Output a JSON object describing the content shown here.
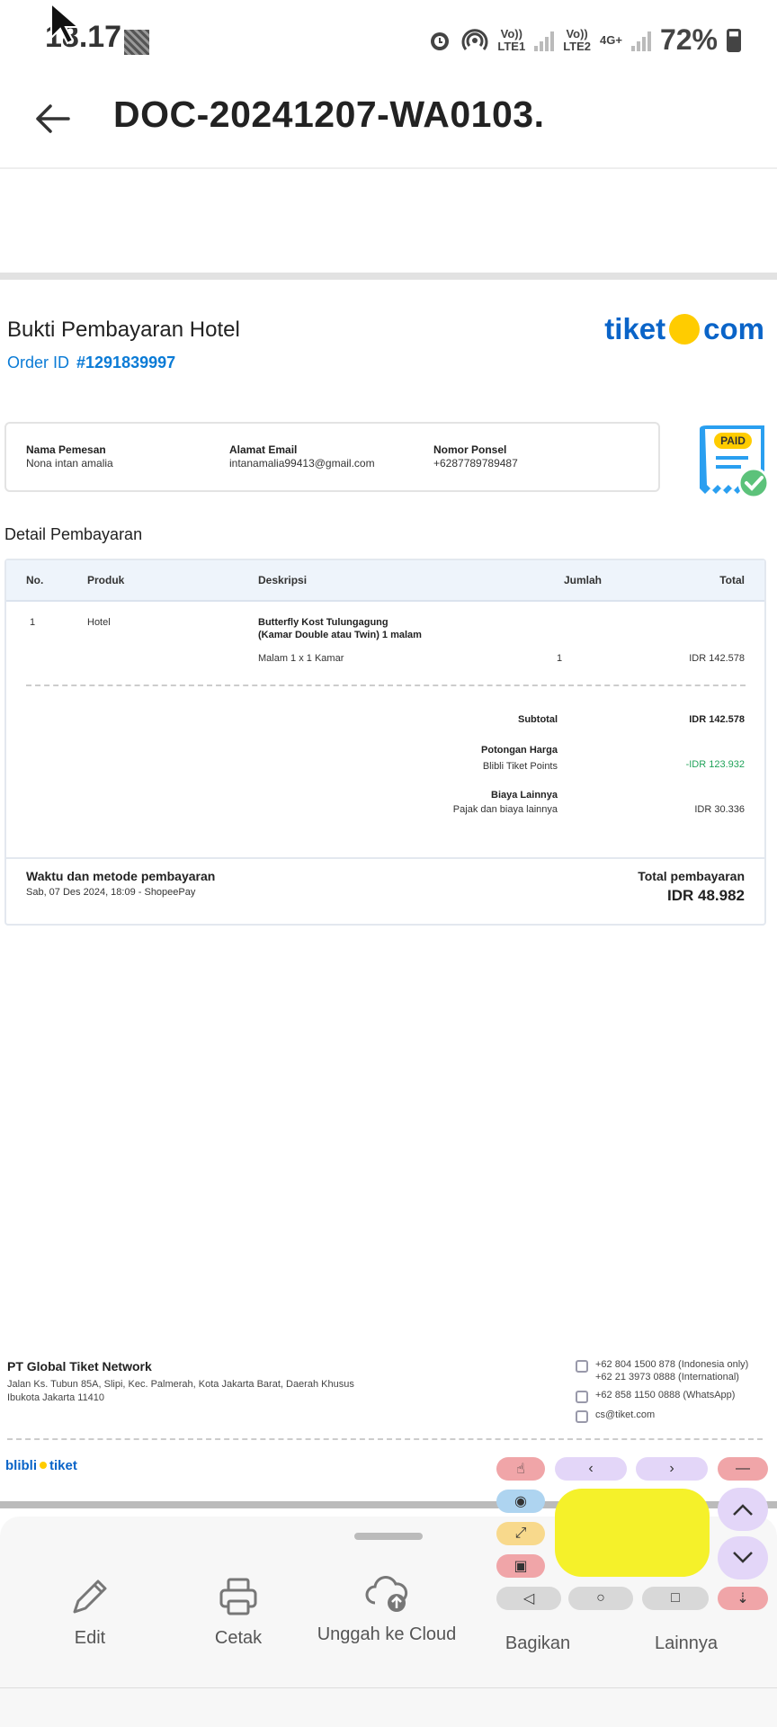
{
  "status_bar": {
    "time": "18.17",
    "sim1": "Vo))\nLTE1",
    "sim2": "Vo))\nLTE2",
    "net": "4G+",
    "battery": "72%"
  },
  "app_bar": {
    "title": "DOC-20241207-WA0103."
  },
  "document": {
    "heading": "Bukti Pembayaran Hotel",
    "order_label": "Order ID",
    "order_id": "#1291839997",
    "brand_left": "tiket",
    "brand_right": "com",
    "paid_stamp": "PAID",
    "customer": {
      "name_label": "Nama Pemesan",
      "name": "Nona intan amalia",
      "email_label": "Alamat Email",
      "email": "intanamalia99413@gmail.com",
      "phone_label": "Nomor Ponsel",
      "phone": "+6287789789487"
    },
    "detail_heading": "Detail Pembayaran",
    "table": {
      "headers": [
        "No.",
        "Produk",
        "Deskripsi",
        "Jumlah",
        "Total"
      ],
      "row": {
        "no": "1",
        "product": "Hotel",
        "desc_line1": "Butterfly Kost Tulungagung",
        "desc_line2": "(Kamar Double atau Twin) 1 malam",
        "desc_sub": "Malam 1 x 1 Kamar",
        "qty": "1",
        "total": "IDR 142.578"
      },
      "subtotal_label": "Subtotal",
      "subtotal": "IDR 142.578",
      "discount_label": "Potongan Harga",
      "discount_sub": "Blibli Tiket Points",
      "discount": "-IDR 123.932",
      "other_label": "Biaya Lainnya",
      "other_sub": "Pajak dan biaya lainnya",
      "other": "IDR 30.336",
      "pay_label": "Waktu dan metode pembayaran",
      "pay_detail": "Sab, 07 Des 2024, 18:09 - ShopeePay",
      "total_label": "Total pembayaran",
      "total": "IDR 48.982"
    },
    "footer": {
      "company": "PT Global Tiket Network",
      "address": "Jalan Ks. Tubun 85A, Slipi, Kec. Palmerah, Kota Jakarta Barat, Daerah Khusus Ibukota Jakarta 11410",
      "phone1": "+62 804 1500 878 (Indonesia only)",
      "phone2": "+62 21 3973 0888 (International)",
      "whatsapp": "+62 858 1150 0888 (WhatsApp)",
      "email": "cs@tiket.com",
      "brand_left": "blibli",
      "brand_right": "tiket"
    }
  },
  "actions": [
    {
      "label": "Edit",
      "icon": "pencil-icon"
    },
    {
      "label": "Cetak",
      "icon": "printer-icon"
    },
    {
      "label": "Unggah ke Cloud",
      "icon": "cloud-upload-icon"
    },
    {
      "label": "Bagikan",
      "icon": "share-icon"
    },
    {
      "label": "Lainnya",
      "icon": "more-icon"
    }
  ],
  "colors": {
    "accent_blue": "#0a7bd6",
    "brand_yellow": "#ffcc00",
    "discount_green": "#21a35a"
  }
}
